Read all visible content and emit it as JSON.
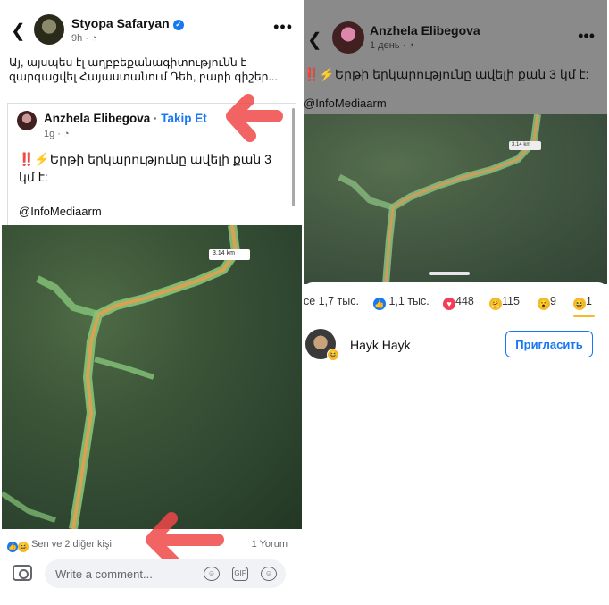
{
  "left": {
    "author": "Styopa Safaryan",
    "time": "9h · ",
    "post_text": "Այ, այսպես էլ աղբբեքանագիտությունն է զարգացվել Հայաստանում Դեհ, բարի գիշեր...",
    "shared": {
      "author": "Anzhela Elibegova",
      "separator": " · ",
      "follow": "Takip Et",
      "time": "1g · ",
      "text": "‼️⚡Երթի երկարությունը ավելի քան 3 կմ է:",
      "tag": "@InfoMediaarm"
    },
    "map_label": "3.14 km",
    "reactions_text": "Sen ve 2 diğer kişi",
    "comments_count": "1 Yorum",
    "comment_placeholder": "Write a comment...",
    "gif_label": "GIF"
  },
  "right": {
    "author": "Anzhela Elibegova",
    "time": "1 день · ",
    "text": "‼️⚡Երթի երկարությունը ավելի քան 3 կմ է:",
    "tag": "@InfoMediaarm",
    "map_label": "3.14 km",
    "tabs": [
      {
        "label": "се 1,7 тыс."
      },
      {
        "label": "1,1 тыс."
      },
      {
        "label": "448"
      },
      {
        "label": "115"
      },
      {
        "label": "9"
      },
      {
        "label": "1"
      }
    ],
    "person": {
      "name": "Hayk Hayk",
      "button": "Пригласить"
    }
  },
  "colors": {
    "accent": "#1877f2",
    "annotation": "#f04848",
    "route_green": "#86c47a",
    "route_orange": "#d9a253"
  }
}
